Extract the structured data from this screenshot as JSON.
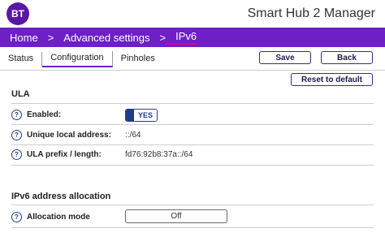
{
  "header": {
    "logo_text": "BT",
    "title": "Smart Hub 2 Manager"
  },
  "breadcrumb": [
    "Home",
    "Advanced settings",
    "IPv6"
  ],
  "tabs": [
    "Status",
    "Configuration",
    "Pinholes"
  ],
  "actions": {
    "save": "Save",
    "back": "Back",
    "reset": "Reset to default"
  },
  "ula": {
    "title": "ULA",
    "enabled_label": "Enabled:",
    "enabled_value": "YES",
    "address_label": "Unique local address:",
    "address_value": "::/64",
    "prefix_label": "ULA prefix / length:",
    "prefix_value": "fd76:92b8:37a::/64"
  },
  "allocation": {
    "title": "IPv6 address allocation",
    "mode_label": "Allocation mode",
    "mode_value": "Off"
  },
  "help_glyph": "?"
}
